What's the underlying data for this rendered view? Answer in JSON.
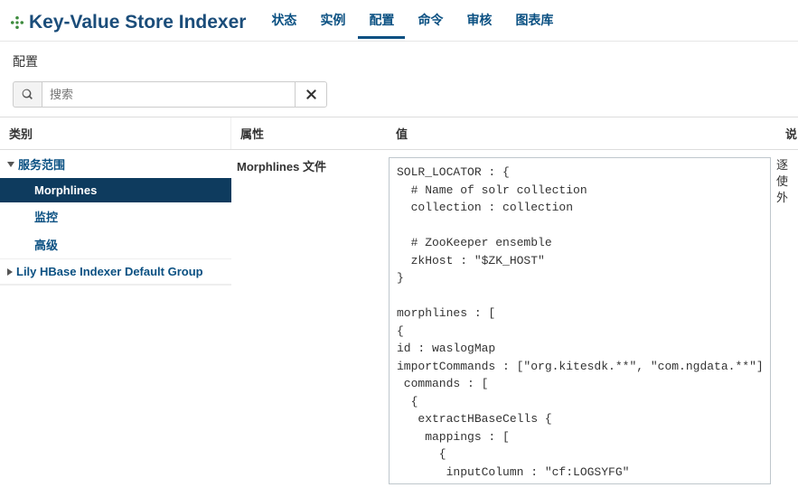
{
  "header": {
    "title": "Key-Value Store Indexer",
    "tabs": [
      {
        "label": "状态",
        "active": false
      },
      {
        "label": "实例",
        "active": false
      },
      {
        "label": "配置",
        "active": true
      },
      {
        "label": "命令",
        "active": false
      },
      {
        "label": "审核",
        "active": false
      },
      {
        "label": "图表库",
        "active": false
      }
    ]
  },
  "section": {
    "title": "配置"
  },
  "search": {
    "placeholder": "搜索"
  },
  "columns": {
    "category": "类别",
    "attribute": "属性",
    "value": "值",
    "description": "说"
  },
  "categories": {
    "groups": [
      {
        "label": "服务范围",
        "expanded": true,
        "items": [
          {
            "label": "Morphlines",
            "active": true
          },
          {
            "label": "监控",
            "active": false
          },
          {
            "label": "高级",
            "active": false
          }
        ]
      },
      {
        "label": "Lily HBase Indexer Default Group",
        "expanded": false,
        "items": []
      }
    ]
  },
  "attribute": {
    "label": "Morphlines 文件"
  },
  "description": {
    "text": "逐使外"
  },
  "value": {
    "code": "SOLR_LOCATOR : {\n  # Name of solr collection\n  collection : collection\n\n  # ZooKeeper ensemble\n  zkHost : \"$ZK_HOST\"\n}\n\nmorphlines : [\n{\nid : waslogMap\nimportCommands : [\"org.kitesdk.**\", \"com.ngdata.**\"]\n commands : [\n  {\n   extractHBaseCells {\n    mappings : [\n      {\n       inputColumn : \"cf:LOGSYFG\""
  }
}
